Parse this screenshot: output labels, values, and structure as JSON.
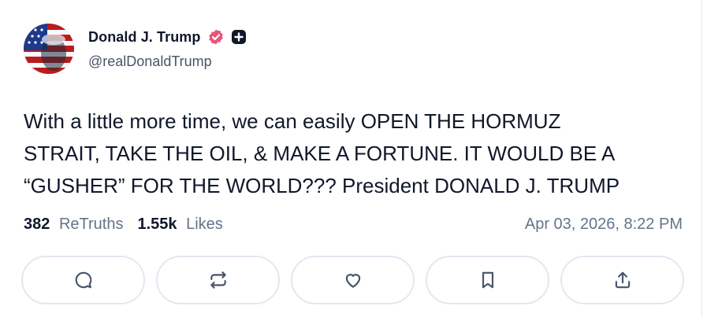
{
  "author": {
    "display_name": "Donald J. Trump",
    "handle": "@realDonaldTrump",
    "verified_badge_icon": "verified-badge-icon",
    "plus_badge_icon": "plus-badge-icon",
    "badge_color": "#e8557a"
  },
  "post": {
    "line1": "With a little more time, we can easily OPEN THE HORMUZ",
    "line2": "STRAIT, TAKE THE OIL, & MAKE A FORTUNE. IT WOULD BE A",
    "line3": "“GUSHER” FOR THE WORLD??? President DONALD J. TRUMP"
  },
  "stats": {
    "retruths_count": "382",
    "retruths_label": "ReTruths",
    "likes_count": "1.55k",
    "likes_label": "Likes",
    "timestamp": "Apr 03, 2026, 8:22 PM"
  },
  "actions": [
    {
      "icon": "reply-icon"
    },
    {
      "icon": "retruth-icon"
    },
    {
      "icon": "like-heart-icon"
    },
    {
      "icon": "bookmark-icon"
    },
    {
      "icon": "share-icon"
    }
  ],
  "colors": {
    "text": "#0f172a",
    "muted": "#64748b",
    "border": "#e2e8f0",
    "icon": "#475569"
  }
}
